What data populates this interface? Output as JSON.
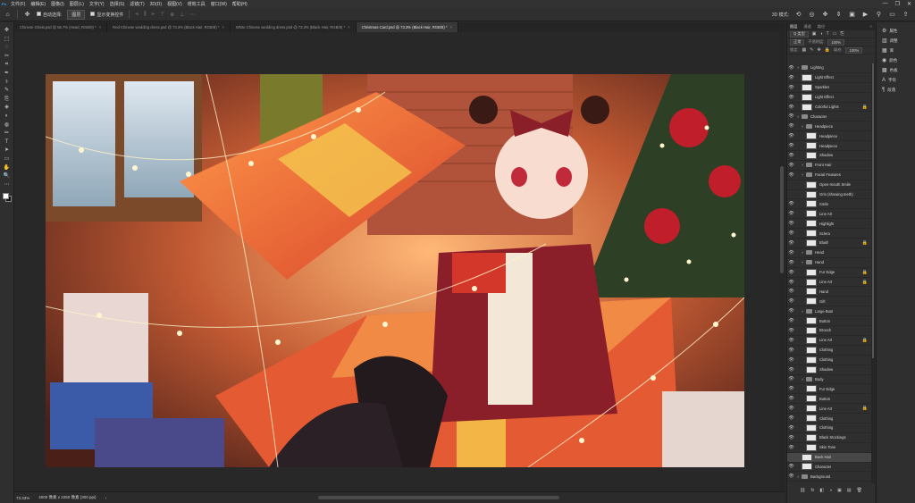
{
  "menubar": {
    "logo": "Ps",
    "items": [
      "文件(F)",
      "编辑(E)",
      "图像(I)",
      "图层(L)",
      "文字(Y)",
      "选择(S)",
      "滤镜(T)",
      "3D(D)",
      "视图(V)",
      "增效工具",
      "窗口(W)",
      "帮助(H)"
    ],
    "window_controls": [
      "—",
      "❐",
      "✕"
    ]
  },
  "options": {
    "home_icon": "home-icon",
    "move_icon": "move-tool-icon",
    "auto_select_label": "自动选择:",
    "auto_select_target": "图层",
    "transform_label": "显示变换控件",
    "mode_3d": "3D 模式:"
  },
  "tabs": [
    {
      "label": "Chinese Ghost.psd @ 66.7% (Head, RGB/8) *",
      "close": "×",
      "active": false
    },
    {
      "label": "Red Chinese wedding dress.psd @ 73.3% (Black Hair, RGB/8) *",
      "close": "×",
      "active": false
    },
    {
      "label": "White Chinese wedding dress.psd @ 73.3% (Black Hair, RGB/8) *",
      "close": "×",
      "active": false
    },
    {
      "label": "Christmas Card.psd @ 73.3% (Black Hair, RGB/8) *",
      "close": "×",
      "active": true
    }
  ],
  "tools": [
    "✥",
    "⬚",
    "◌",
    "✂",
    "⌗",
    "✒",
    "⚕",
    "✎",
    "⎘",
    "◈",
    "◐",
    "◍",
    "✏",
    "T",
    "➤",
    "▭",
    "✋",
    "🔍",
    "⋯"
  ],
  "status": {
    "zoom": "73.33%",
    "doc": "4000 像素 x 2250 像素 (300 ppi)",
    "arrow": "›"
  },
  "panel": {
    "tabs": [
      "图层",
      "通道",
      "路径"
    ],
    "menu": "≡",
    "filter_kind": "Q 类型",
    "blend_mode": "正常",
    "opacity_label": "不透明度:",
    "opacity_value": "100%",
    "lock_label": "锁定:",
    "fill_label": "填充:",
    "fill_value": "100%",
    "footer_icons": [
      "⛓",
      "fx",
      "◧",
      "◑",
      "▣",
      "▤",
      "🗑"
    ]
  },
  "layers": [
    {
      "name": "Lighting",
      "type": "group",
      "indent": 0,
      "eye": true,
      "lock": false,
      "sel": false
    },
    {
      "name": "Light Effect",
      "type": "layer",
      "indent": 1,
      "eye": true,
      "lock": false,
      "sel": false
    },
    {
      "name": "Sparkles",
      "type": "layer",
      "indent": 1,
      "eye": true,
      "lock": false,
      "sel": false
    },
    {
      "name": "Light Effect",
      "type": "layer",
      "indent": 1,
      "eye": true,
      "lock": false,
      "sel": false
    },
    {
      "name": "Colorful Lights",
      "type": "layer",
      "indent": 1,
      "eye": true,
      "lock": true,
      "sel": false
    },
    {
      "name": "Character",
      "type": "group",
      "indent": 0,
      "eye": true,
      "lock": false,
      "sel": false
    },
    {
      "name": "Headpiece",
      "type": "group",
      "indent": 1,
      "eye": true,
      "lock": false,
      "sel": false
    },
    {
      "name": "Headpiece",
      "type": "layer",
      "indent": 2,
      "eye": true,
      "lock": false,
      "sel": false
    },
    {
      "name": "Headpiece",
      "type": "layer",
      "indent": 2,
      "eye": true,
      "lock": false,
      "sel": false
    },
    {
      "name": "Shadow",
      "type": "layer",
      "indent": 2,
      "eye": true,
      "lock": false,
      "sel": false
    },
    {
      "name": "Front Hair",
      "type": "group",
      "indent": 1,
      "eye": true,
      "lock": false,
      "sel": false
    },
    {
      "name": "Facial Features",
      "type": "group",
      "indent": 1,
      "eye": true,
      "lock": false,
      "sel": false
    },
    {
      "name": "Open-mouth Smile",
      "type": "layer",
      "indent": 2,
      "eye": false,
      "lock": false,
      "sel": false
    },
    {
      "name": "Grin (showing teeth)",
      "type": "layer",
      "indent": 2,
      "eye": false,
      "lock": false,
      "sel": false
    },
    {
      "name": "Smile",
      "type": "layer",
      "indent": 2,
      "eye": true,
      "lock": false,
      "sel": false
    },
    {
      "name": "Line Art",
      "type": "layer",
      "indent": 2,
      "eye": true,
      "lock": false,
      "sel": false
    },
    {
      "name": "Highlight",
      "type": "layer",
      "indent": 2,
      "eye": true,
      "lock": false,
      "sel": false
    },
    {
      "name": "Sclera",
      "type": "layer",
      "indent": 2,
      "eye": true,
      "lock": false,
      "sel": false
    },
    {
      "name": "Blush",
      "type": "layer",
      "indent": 2,
      "eye": true,
      "lock": true,
      "sel": false
    },
    {
      "name": "Head",
      "type": "group",
      "indent": 1,
      "eye": true,
      "lock": false,
      "sel": false
    },
    {
      "name": "Hand",
      "type": "group",
      "indent": 1,
      "eye": true,
      "lock": false,
      "sel": false
    },
    {
      "name": "Fur Edge",
      "type": "layer",
      "indent": 2,
      "eye": true,
      "lock": true,
      "sel": false
    },
    {
      "name": "Line Art",
      "type": "layer",
      "indent": 2,
      "eye": true,
      "lock": true,
      "sel": false
    },
    {
      "name": "Hand",
      "type": "layer",
      "indent": 2,
      "eye": true,
      "lock": false,
      "sel": false
    },
    {
      "name": "Gift",
      "type": "layer",
      "indent": 2,
      "eye": true,
      "lock": false,
      "sel": false
    },
    {
      "name": "Large Bust",
      "type": "group",
      "indent": 1,
      "eye": true,
      "lock": false,
      "sel": false
    },
    {
      "name": "Button",
      "type": "layer",
      "indent": 2,
      "eye": true,
      "lock": false,
      "sel": false
    },
    {
      "name": "Brooch",
      "type": "layer",
      "indent": 2,
      "eye": true,
      "lock": false,
      "sel": false
    },
    {
      "name": "Line Art",
      "type": "layer",
      "indent": 2,
      "eye": true,
      "lock": true,
      "sel": false
    },
    {
      "name": "Clothing",
      "type": "layer",
      "indent": 2,
      "eye": true,
      "lock": false,
      "sel": false
    },
    {
      "name": "Clothing",
      "type": "layer",
      "indent": 2,
      "eye": true,
      "lock": false,
      "sel": false
    },
    {
      "name": "Shadow",
      "type": "layer",
      "indent": 2,
      "eye": true,
      "lock": false,
      "sel": false
    },
    {
      "name": "Body",
      "type": "group",
      "indent": 1,
      "eye": true,
      "lock": false,
      "sel": false
    },
    {
      "name": "Fur Edge",
      "type": "layer",
      "indent": 2,
      "eye": true,
      "lock": false,
      "sel": false
    },
    {
      "name": "Button",
      "type": "layer",
      "indent": 2,
      "eye": true,
      "lock": false,
      "sel": false
    },
    {
      "name": "Line Art",
      "type": "layer",
      "indent": 2,
      "eye": true,
      "lock": true,
      "sel": false
    },
    {
      "name": "Clothing",
      "type": "layer",
      "indent": 2,
      "eye": true,
      "lock": false,
      "sel": false
    },
    {
      "name": "Clothing",
      "type": "layer",
      "indent": 2,
      "eye": true,
      "lock": false,
      "sel": false
    },
    {
      "name": "Black Stockings",
      "type": "layer",
      "indent": 2,
      "eye": true,
      "lock": false,
      "sel": false
    },
    {
      "name": "Skin Tone",
      "type": "layer",
      "indent": 2,
      "eye": true,
      "lock": false,
      "sel": false
    },
    {
      "name": "Back Hair",
      "type": "layer",
      "indent": 1,
      "eye": false,
      "lock": false,
      "sel": true
    },
    {
      "name": "Character",
      "type": "layer",
      "indent": 1,
      "eye": true,
      "lock": false,
      "sel": false
    },
    {
      "name": "Background",
      "type": "group",
      "indent": 0,
      "eye": true,
      "lock": false,
      "sel": false
    }
  ],
  "right_strip": [
    {
      "icon": "⚙",
      "label": "属性"
    },
    {
      "icon": "▥",
      "label": "调整"
    },
    {
      "icon": "▦",
      "label": "库"
    },
    {
      "icon": "◉",
      "label": "颜色"
    },
    {
      "icon": "▩",
      "label": "色板"
    },
    {
      "icon": "A",
      "label": "字符"
    },
    {
      "icon": "¶",
      "label": "段落"
    }
  ],
  "colors": {
    "foreground": "#ffffff",
    "background": "#111111",
    "accent": "#31a8ff"
  }
}
